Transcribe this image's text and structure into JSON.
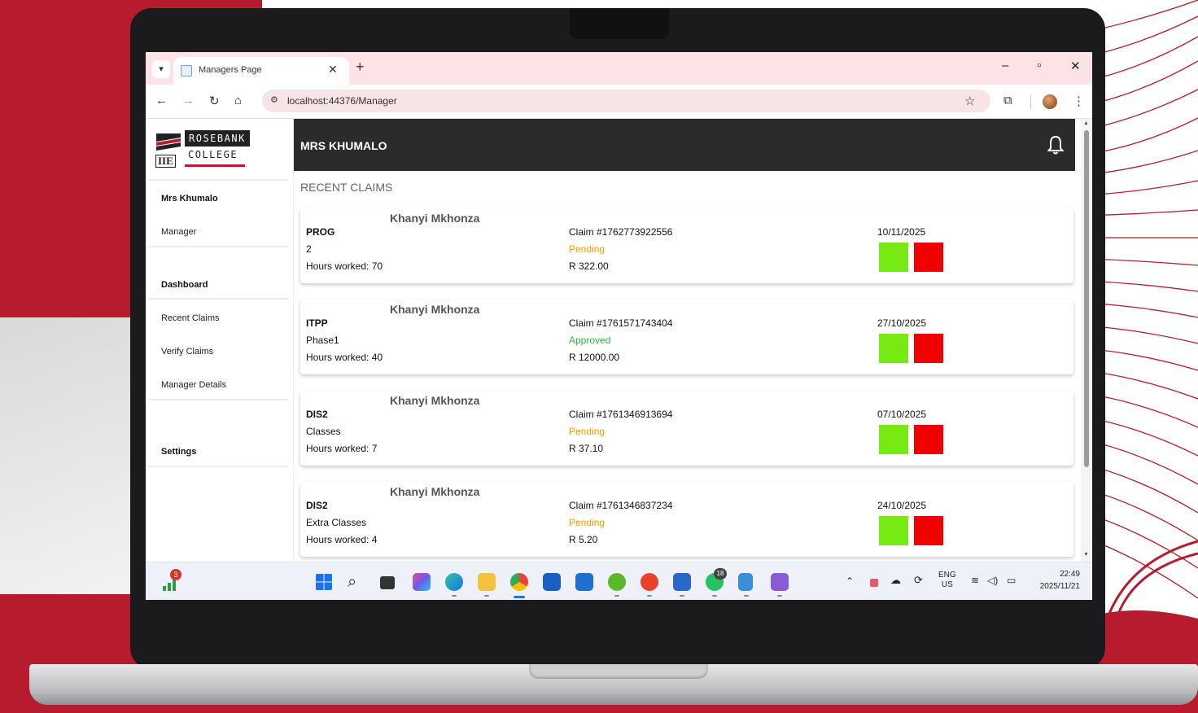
{
  "browser": {
    "tab_title": "Managers Page",
    "url": "localhost:44376/Manager"
  },
  "logo": {
    "line1": "ROSEBANK",
    "line2": "COLLEGE",
    "badge": "IIE"
  },
  "sidebar": {
    "user_name": "Mrs Khumalo",
    "role": "Manager",
    "dashboard": "Dashboard",
    "items": [
      "Recent Claims",
      "Verify Claims",
      "Manager Details"
    ],
    "settings": "Settings"
  },
  "header": {
    "title": "MRS KHUMALO",
    "bell_icon": "bell-icon"
  },
  "section_title": "RECENT CLAIMS",
  "claims": [
    {
      "lecturer": "Khanyi Mkhonza",
      "module": "PROG",
      "description": "2",
      "hours": "Hours worked: 70",
      "claim_no": "Claim #1762773922556",
      "status": "Pending",
      "amount": "R 322.00",
      "date": "10/11/2025"
    },
    {
      "lecturer": "Khanyi Mkhonza",
      "module": "ITPP",
      "description": "Phase1",
      "hours": "Hours worked: 40",
      "claim_no": "Claim #1761571743404",
      "status": "Approved",
      "amount": "R 12000.00",
      "date": "27/10/2025"
    },
    {
      "lecturer": "Khanyi Mkhonza",
      "module": "DIS2",
      "description": "Classes",
      "hours": "Hours worked: 7",
      "claim_no": "Claim #1761346913694",
      "status": "Pending",
      "amount": "R 37.10",
      "date": "07/10/2025"
    },
    {
      "lecturer": "Khanyi Mkhonza",
      "module": "DIS2",
      "description": "Extra Classes",
      "hours": "Hours worked: 4",
      "claim_no": "Claim #1761346837234",
      "status": "Pending",
      "amount": "R 5.20",
      "date": "24/10/2025"
    }
  ],
  "colors": {
    "pending": "#ff9900",
    "approved": "#3cb043",
    "approve_button": "#76ea12",
    "reject_button": "#f00000",
    "topbar": "#2b2b2d",
    "brand_red": "#b71c2e"
  },
  "taskbar": {
    "weather_badge": "3",
    "whatsapp_badge": "18",
    "lang": "ENG",
    "region": "US",
    "time": "22:49",
    "date": "2025/11/21"
  }
}
